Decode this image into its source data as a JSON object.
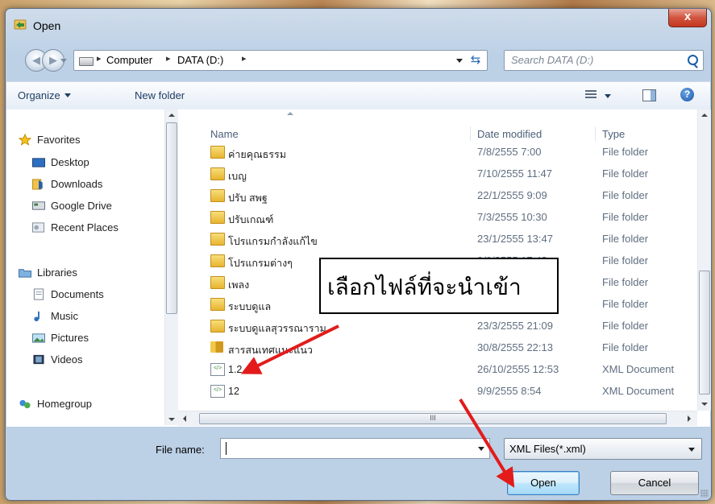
{
  "window": {
    "title": "Open",
    "close_label": "x"
  },
  "address": {
    "segments": [
      "Computer",
      "DATA (D:)"
    ],
    "separator": "▸",
    "search_placeholder": "Search DATA (D:)"
  },
  "toolbar": {
    "organize_label": "Organize",
    "new_folder_label": "New folder"
  },
  "nav": {
    "favorites": "Favorites",
    "desktop": "Desktop",
    "downloads": "Downloads",
    "google_drive": "Google Drive",
    "recent_places": "Recent Places",
    "libraries": "Libraries",
    "documents": "Documents",
    "music": "Music",
    "pictures": "Pictures",
    "videos": "Videos",
    "homegroup": "Homegroup"
  },
  "columns": {
    "name": "Name",
    "date_modified": "Date modified",
    "type": "Type"
  },
  "files": [
    {
      "name": "ค่ายคุณธรรม",
      "date": "7/8/2555 7:00",
      "type": "File folder",
      "icon": "folder-icon"
    },
    {
      "name": "เบญ",
      "date": "7/10/2555 11:47",
      "type": "File folder",
      "icon": "folder-icon"
    },
    {
      "name": "ปรับ สพฐ",
      "date": "22/1/2555 9:09",
      "type": "File folder",
      "icon": "folder-icon"
    },
    {
      "name": "ปรับเกณฑ์",
      "date": "7/3/2555 10:30",
      "type": "File folder",
      "icon": "folder-icon"
    },
    {
      "name": "โปรแกรมกำลังแก้ไข",
      "date": "23/1/2555 13:47",
      "type": "File folder",
      "icon": "folder-icon"
    },
    {
      "name": "โปรแกรมต่างๆ",
      "date": "9/9/2555 17:43",
      "type": "File folder",
      "icon": "folder-icon"
    },
    {
      "name": "เพลง",
      "date": "",
      "type": "File folder",
      "icon": "folder-icon"
    },
    {
      "name": "ระบบดูแล",
      "date": "",
      "type": "File folder",
      "icon": "folder-icon"
    },
    {
      "name": "ระบบดูแลสุวรรณาราม",
      "date": "23/3/2555 21:09",
      "type": "File folder",
      "icon": "folder-icon"
    },
    {
      "name": "สารสนเทศแนะแนว",
      "date": "30/8/2555 22:13",
      "type": "File folder",
      "icon": "folder-icon"
    },
    {
      "name": "1.2",
      "date": "26/10/2555 12:53",
      "type": "XML Document",
      "icon": "xml-file-icon"
    },
    {
      "name": "12",
      "date": "9/9/2555 8:54",
      "type": "XML Document",
      "icon": "xml-file-icon"
    }
  ],
  "scroll": {
    "h_thumb_label": "III"
  },
  "footer": {
    "file_name_label": "File name:",
    "file_name_value": "",
    "file_type_value": "XML Files(*.xml)",
    "open_label": "Open",
    "cancel_label": "Cancel"
  },
  "annotation": {
    "callout_text": "เลือกไฟล์ที่จะนำเข้า",
    "arrow_color": "#e31b1b"
  }
}
